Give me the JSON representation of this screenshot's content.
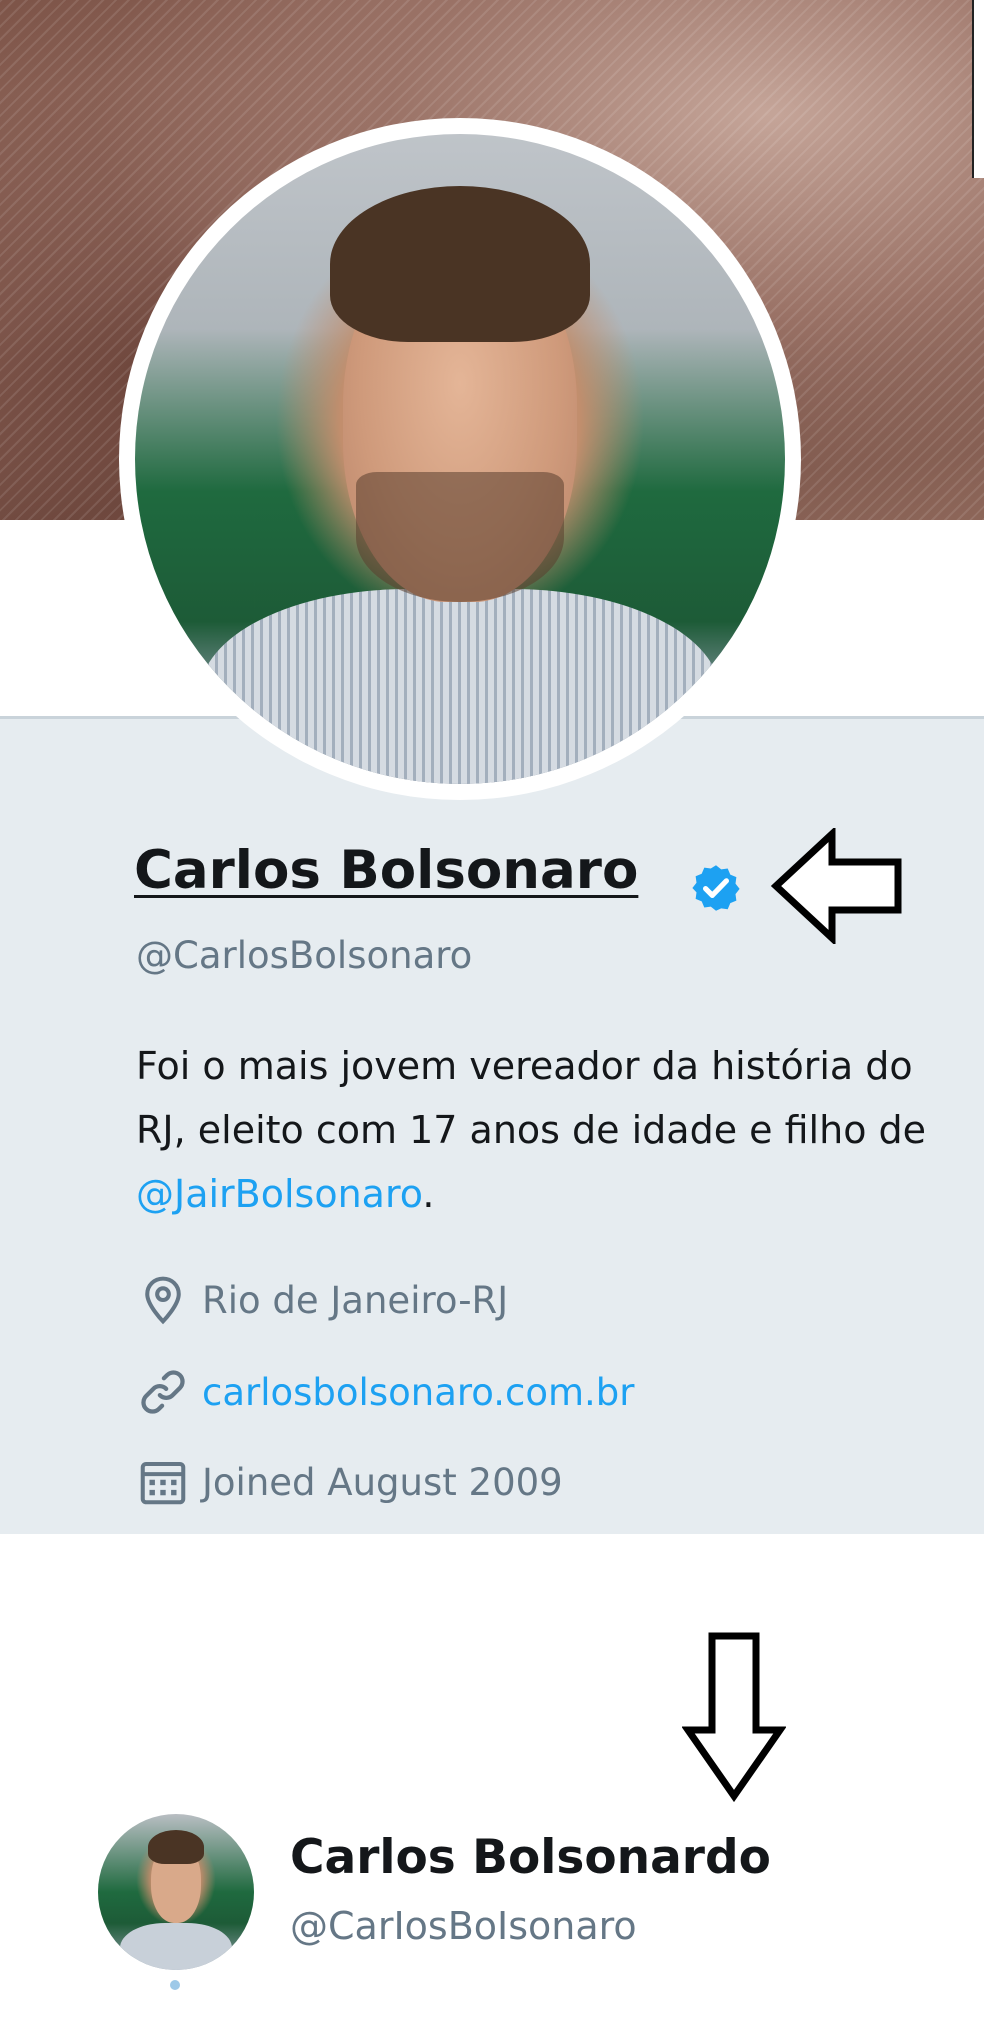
{
  "profile": {
    "name": "Carlos Bolsonaro",
    "handle": "@CarlosBolsonaro",
    "verified_icon": "verified-badge-icon",
    "bio": {
      "line1": "Foi o mais jovem vereador da história do",
      "line2": "RJ, eleito com 17 anos de idade e filho de",
      "mention": "@JairBolsonaro",
      "suffix": "."
    },
    "location": "Rio de Janeiro-RJ",
    "website": "carlosbolsonaro.com.br",
    "joined": "Joined August 2009",
    "icons": {
      "location": "location-pin-icon",
      "website": "link-icon",
      "joined": "calendar-icon"
    }
  },
  "impostor": {
    "name": "Carlos Bolsonardo",
    "handle": "@CarIosBoIsonaro"
  },
  "annotations": {
    "arrow_to_name": "left-arrow-icon",
    "arrow_to_impostor": "down-arrow-icon"
  },
  "colors": {
    "panel_background": "#e6ecf0",
    "link": "#1da1f2",
    "muted_text": "#657786",
    "primary_text": "#14171a",
    "verified": "#1da1f2"
  }
}
